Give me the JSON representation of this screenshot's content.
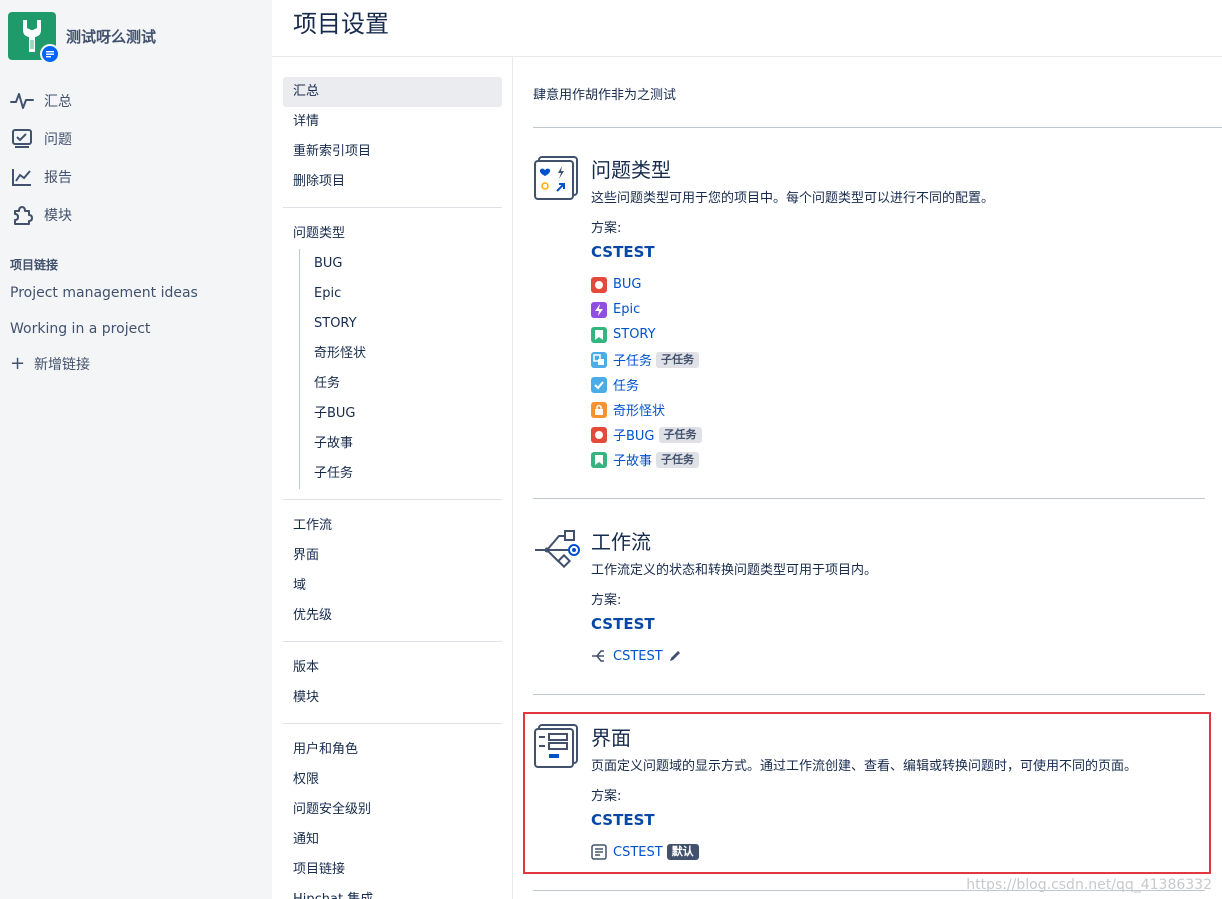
{
  "sidebar": {
    "project_name": "测试呀么测试",
    "nav": [
      {
        "label": "汇总",
        "icon": "activity-icon"
      },
      {
        "label": "问题",
        "icon": "issues-icon"
      },
      {
        "label": "报告",
        "icon": "reports-icon"
      },
      {
        "label": "模块",
        "icon": "puzzle-icon"
      }
    ],
    "links_title": "项目链接",
    "links": [
      "Project management ideas",
      "Working in a project"
    ],
    "add_link": "新增链接"
  },
  "page": {
    "title": "项目设置"
  },
  "menu": {
    "group1": [
      "汇总",
      "详情",
      "重新索引项目",
      "删除项目"
    ],
    "issue_types_title": "问题类型",
    "issue_types": [
      "BUG",
      "Epic",
      "STORY",
      "奇形怪状",
      "任务",
      "子BUG",
      "子故事",
      "子任务"
    ],
    "group3": [
      "工作流",
      "界面",
      "域",
      "优先级"
    ],
    "group4": [
      "版本",
      "模块"
    ],
    "group5": [
      "用户和角色",
      "权限",
      "问题安全级别",
      "通知",
      "项目链接",
      "Hipchat 集成"
    ]
  },
  "content": {
    "description": "肆意用作胡作非为之测试",
    "issue_types": {
      "title": "问题类型",
      "desc": "这些问题类型可用于您的项目中。每个问题类型可以进行不同的配置。",
      "scheme_label": "方案:",
      "scheme_name": "CSTEST",
      "items": [
        {
          "label": "BUG",
          "color": "#e5493a",
          "icon": "bug-icon",
          "tag": ""
        },
        {
          "label": "Epic",
          "color": "#904ee2",
          "icon": "epic-icon",
          "tag": ""
        },
        {
          "label": "STORY",
          "color": "#36b37e",
          "icon": "story-icon",
          "tag": ""
        },
        {
          "label": "子任务",
          "color": "#4bade8",
          "icon": "subtask-icon",
          "tag": "子任务"
        },
        {
          "label": "任务",
          "color": "#4bade8",
          "icon": "task-icon",
          "tag": ""
        },
        {
          "label": "奇形怪状",
          "color": "#f79232",
          "icon": "lock-icon",
          "tag": ""
        },
        {
          "label": "子BUG",
          "color": "#e5493a",
          "icon": "bug-icon",
          "tag": "子任务"
        },
        {
          "label": "子故事",
          "color": "#36b37e",
          "icon": "story-icon",
          "tag": "子任务"
        }
      ]
    },
    "workflow": {
      "title": "工作流",
      "desc": "工作流定义的状态和转换问题类型可用于项目内。",
      "scheme_label": "方案:",
      "scheme_name": "CSTEST",
      "item_label": "CSTEST"
    },
    "screens": {
      "title": "界面",
      "desc": "页面定义问题域的显示方式。通过工作流创建、查看、编辑或转换问题时，可使用不同的页面。",
      "scheme_label": "方案:",
      "scheme_name": "CSTEST",
      "item_label": "CSTEST",
      "default_tag": "默认"
    }
  },
  "watermark": "https://blog.csdn.net/qq_41386332",
  "colors": {
    "highlight": "#e0383e",
    "link": "#0052cc",
    "scheme": "#0747a6"
  }
}
